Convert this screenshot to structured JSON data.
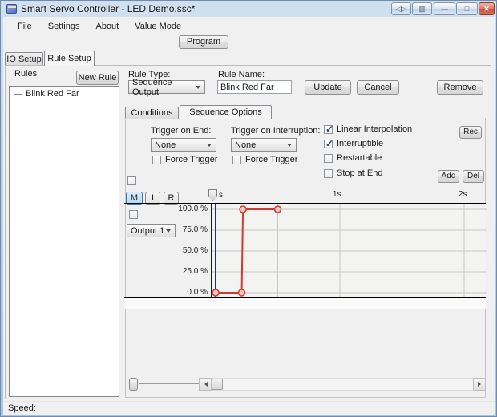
{
  "window": {
    "title": "Smart Servo Controller - LED Demo.ssc*",
    "status_text": "Speed:"
  },
  "titlebar": {
    "extra_button_1_glyph": "◁▷",
    "extra_button_2_glyph": "▥",
    "minimize_glyph": "—",
    "maximize_glyph": "□",
    "close_glyph": "✕"
  },
  "menu": {
    "items": [
      "File",
      "Settings",
      "About",
      "Value Mode"
    ]
  },
  "toolbar": {
    "program_label": "Program"
  },
  "main_tabs": [
    {
      "label": "IO Setup",
      "active": false
    },
    {
      "label": "Rule Setup",
      "active": true
    }
  ],
  "rules_panel": {
    "title": "Rules",
    "new_rule_label": "New Rule",
    "items": [
      {
        "label": "Blink Red Far",
        "selected": false
      }
    ]
  },
  "rule_editor": {
    "rule_type_label": "Rule Type:",
    "rule_type_value": "Sequence Output",
    "rule_name_label": "Rule Name:",
    "rule_name_value": "Blink Red Far",
    "update_label": "Update",
    "cancel_label": "Cancel",
    "remove_label": "Remove"
  },
  "option_tabs": [
    {
      "label": "Conditions",
      "active": false
    },
    {
      "label": "Sequence Options",
      "active": true
    }
  ],
  "sequence_options": {
    "trigger_on_end_label": "Trigger on End:",
    "trigger_on_end_value": "None",
    "force_trigger_end_label": "Force Trigger",
    "force_trigger_end_checked": false,
    "trigger_on_interruption_label": "Trigger on Interruption:",
    "trigger_on_interruption_value": "None",
    "force_trigger_interruption_label": "Force Trigger",
    "force_trigger_interruption_checked": false,
    "flags": [
      {
        "label": "Linear Interpolation",
        "checked": true
      },
      {
        "label": "Interruptible",
        "checked": true
      },
      {
        "label": "Restartable",
        "checked": false
      },
      {
        "label": "Stop at End",
        "checked": false
      }
    ],
    "rec_label": "Rec",
    "add_label": "Add",
    "del_label": "Del",
    "unlabeled_checkbox_checked": false
  },
  "sequence_editor": {
    "mode_buttons": [
      {
        "label": "M",
        "active": true
      },
      {
        "label": "I",
        "active": false
      },
      {
        "label": "R",
        "active": false
      }
    ],
    "channel_checkbox_checked": false,
    "output_selector_value": "Output 1"
  },
  "chart_data": {
    "type": "line",
    "x_unit": "s",
    "xlim": [
      0,
      2.2
    ],
    "ylim": [
      0,
      100
    ],
    "x_ticks": [
      0,
      1,
      2
    ],
    "x_tick_labels": [
      "s",
      "1s",
      "2s"
    ],
    "grid_step_s": 0.5,
    "y_ticks": [
      100,
      75,
      50,
      25,
      0
    ],
    "y_tick_labels": [
      "100.0 %",
      "75.0 %",
      "50.0 %",
      "25.0 %",
      "0.0 %"
    ],
    "grid": true,
    "playhead_s": 0,
    "series": [
      {
        "name": "Output 1",
        "color": "#cf3a32",
        "marker_fill": "#f6c5c0",
        "points": [
          [
            0,
            0
          ],
          [
            0.21,
            0
          ],
          [
            0.22,
            100
          ],
          [
            0.5,
            100
          ]
        ]
      }
    ]
  },
  "colors": {
    "accent_selection": "#b4d9f3",
    "series_red": "#cf3a32",
    "playhead_navy": "#2b2b7d",
    "grid_gray": "#c7c7c7",
    "close_button_red": "#c94f3b"
  }
}
